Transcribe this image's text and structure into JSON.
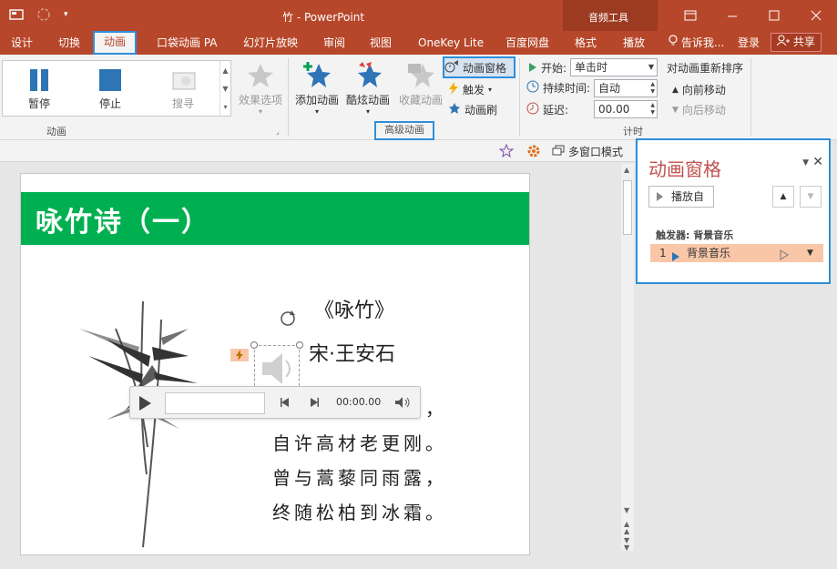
{
  "window": {
    "title": "竹 - PowerPoint",
    "context_title": "音频工具"
  },
  "tabs": [
    {
      "label": "设计"
    },
    {
      "label": "切换"
    },
    {
      "label": "动画",
      "active": true
    },
    {
      "label": "口袋动画 PA"
    },
    {
      "label": "幻灯片放映"
    },
    {
      "label": "审阅"
    },
    {
      "label": "视图"
    },
    {
      "label": "OneKey Lite"
    },
    {
      "label": "百度网盘"
    },
    {
      "label": "格式"
    },
    {
      "label": "播放"
    }
  ],
  "tell_me": "告诉我...",
  "login": "登录",
  "share": "共享",
  "gallery": {
    "items": [
      {
        "label": "暂停"
      },
      {
        "label": "停止"
      },
      {
        "label": "搜寻"
      }
    ],
    "effect_options": "效果选项",
    "group_label": "动画"
  },
  "advanced": {
    "add_animation": "添加动画",
    "fancy_animation": "酷炫动画",
    "collect_animation": "收藏动画",
    "animation_pane": "动画窗格",
    "trigger": "触发",
    "animation_painter": "动画刷",
    "group_label": "高级动画"
  },
  "timing": {
    "start_label": "开始:",
    "start_value": "单击时",
    "duration_label": "持续时间:",
    "duration_value": "自动",
    "delay_label": "延迟:",
    "delay_value": "00.00",
    "reorder_title": "对动画重新排序",
    "move_earlier": "向前移动",
    "move_later": "向后移动",
    "group_label": "计时"
  },
  "strip": {
    "multi_window": "多窗口模式"
  },
  "slide": {
    "banner_title": "咏竹诗（一）",
    "poem_title": "《咏竹》",
    "poem_author": "宋·王安石",
    "poem_line1_tail": "，",
    "poem_line2": "自许高材老更刚。",
    "poem_line3": "曾与蒿藜同雨露，",
    "poem_line4": "终随松柏到冰霜。"
  },
  "player": {
    "time": "00:00.00"
  },
  "pane": {
    "title": "动画窗格",
    "play_button": "播放自",
    "trigger_label": "触发器: 背景音乐",
    "row_index": "1",
    "row_name": "背景音乐"
  },
  "colors": {
    "brand": "#b7472a",
    "highlight": "#2f8fd8",
    "banner": "#00b050",
    "pane_title": "#c0504d",
    "row_bg": "#f9c7a8"
  }
}
